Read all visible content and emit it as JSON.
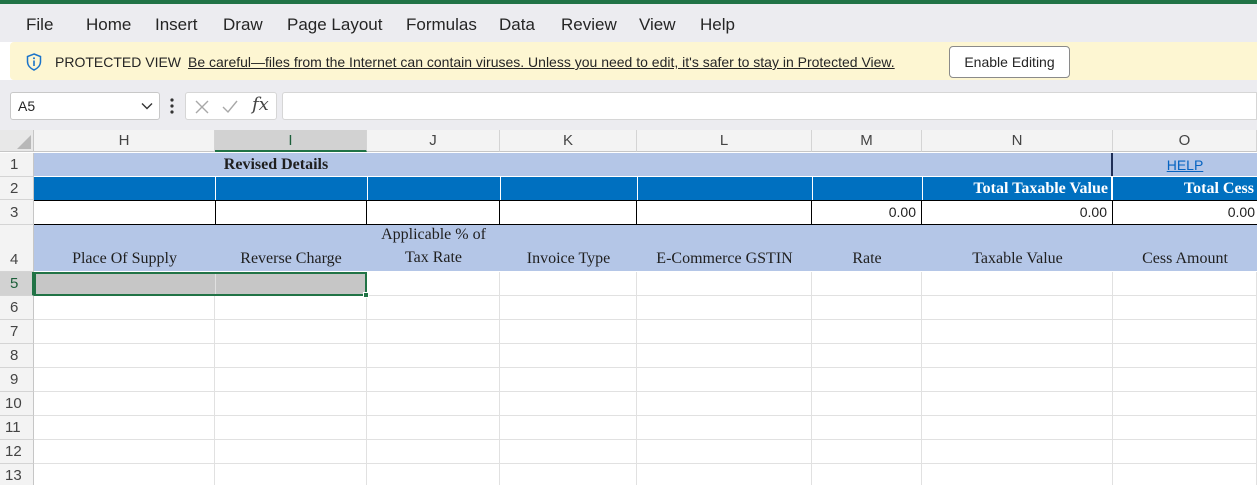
{
  "menu": {
    "items": [
      "File",
      "Home",
      "Insert",
      "Draw",
      "Page Layout",
      "Formulas",
      "Data",
      "Review",
      "View",
      "Help"
    ]
  },
  "protected_view": {
    "label": "PROTECTED VIEW",
    "message": "Be careful—files from the Internet can contain viruses. Unless you need to edit, it's safer to stay in Protected View.",
    "button": "Enable Editing",
    "icon": "shield-info-icon"
  },
  "formula_bar": {
    "name_box": "A5",
    "fx": "fx",
    "formula": ""
  },
  "sheet": {
    "columns": [
      "H",
      "I",
      "J",
      "K",
      "L",
      "M",
      "N",
      "O"
    ],
    "rows": [
      "1",
      "2",
      "3",
      "4",
      "5",
      "6",
      "7",
      "8",
      "9",
      "10",
      "11",
      "12",
      "13"
    ],
    "row1": {
      "title": "Revised Details",
      "help_link": "HELP"
    },
    "row2": {
      "total_taxable_value": "Total Taxable Value",
      "total_cess": "Total Cess"
    },
    "row3": {
      "m": "0.00",
      "n": "0.00",
      "o": "0.00"
    },
    "row4": {
      "place_of_supply": "Place Of Supply",
      "reverse_charge": "Reverse Charge",
      "applicable_line1": "Applicable % of",
      "applicable_line2": "Tax Rate",
      "invoice_type": "Invoice Type",
      "ecommerce_gstin": "E-Commerce GSTIN",
      "rate": "Rate",
      "taxable_value": "Taxable Value",
      "cess_amount": "Cess Amount"
    }
  },
  "colors": {
    "accent_green": "#217346",
    "header_blue": "#0070c0",
    "band_lightblue": "#b4c6e7",
    "protected_yellow": "#fdf6d2",
    "link_blue": "#0563c1"
  }
}
